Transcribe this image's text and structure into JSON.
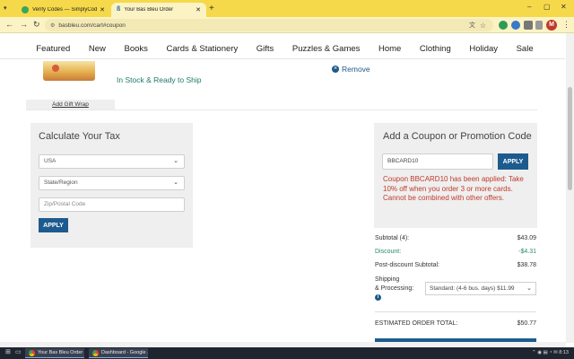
{
  "browser": {
    "tabs": [
      {
        "title": "Verify Codes — SimplyCodes",
        "active": false
      },
      {
        "title": "Your Bas Bleu Order",
        "active": true
      }
    ],
    "url": "basbleu.com/cart#coupon",
    "profile_initial": "M"
  },
  "site_nav": [
    "Featured",
    "New",
    "Books",
    "Cards & Stationery",
    "Gifts",
    "Puzzles & Games",
    "Home",
    "Clothing",
    "Holiday",
    "Sale"
  ],
  "cart_item": {
    "stock_status": "In Stock & Ready to Ship",
    "remove_label": "Remove"
  },
  "gift_wrap_label": "Add Gift Wrap",
  "tax": {
    "title": "Calculate Your Tax",
    "country": "USA",
    "state_placeholder": "State/Region",
    "zip_placeholder": "Zip/Postal Code",
    "apply_label": "APPLY"
  },
  "coupon": {
    "title": "Add a Coupon or Promotion Code",
    "code_value": "BBCARD10",
    "apply_label": "APPLY",
    "message": "Coupon BBCARD10 has been applied: Take 10% off when you order 3 or more cards. Cannot be combined with other offers."
  },
  "summary": {
    "subtotal_label": "Subtotal (4):",
    "subtotal_value": "$43.09",
    "discount_label": "Discount:",
    "discount_value": "-$4.31",
    "post_discount_label": "Post-discount Subtotal:",
    "post_discount_value": "$38.78",
    "shipping_label_1": "Shipping",
    "shipping_label_2": "& Processing:",
    "shipping_option": "Standard: (4-6 bus. days) $11.99",
    "total_label": "ESTIMATED ORDER TOTAL:",
    "total_value": "$50.77"
  },
  "taskbar": {
    "tasks": [
      "Your Bas Bleu Order ...",
      "Dashboard - Google ..."
    ],
    "time": "8:13"
  },
  "colors": {
    "accent": "#1d5b8f",
    "error": "#c0392b",
    "discount": "#2a8a6f",
    "chrome": "#f5d94a"
  }
}
